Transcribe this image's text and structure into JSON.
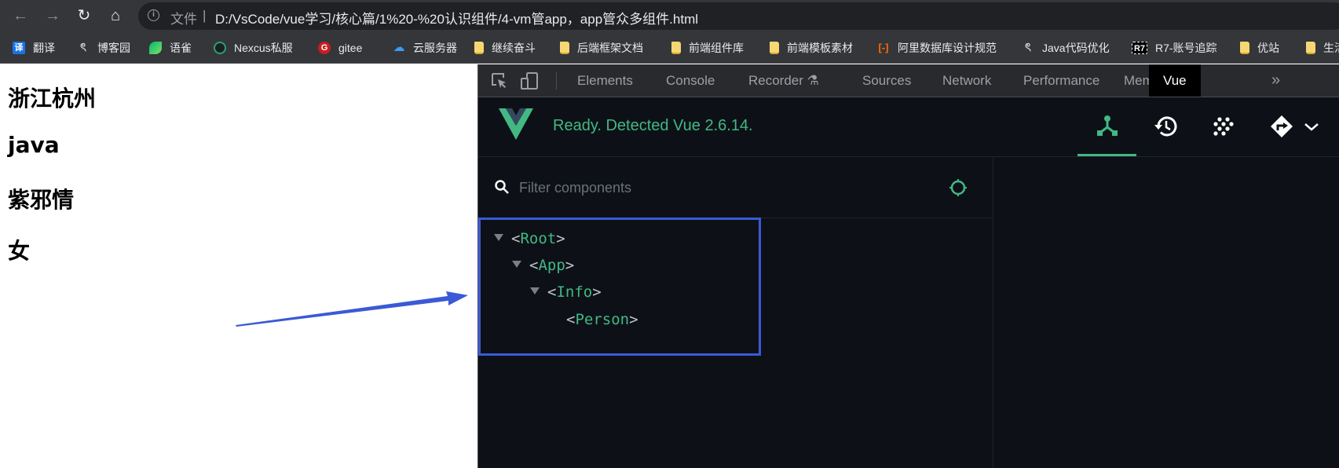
{
  "browser": {
    "nav": {
      "back": "←",
      "forward": "→",
      "reload": "↻",
      "home": "⌂"
    },
    "address": {
      "info_icon": "i",
      "scheme_label": "文件",
      "separator": "|",
      "url": "D:/VsCode/vue学习/核心篇/1%20-%20认识组件/4-vm管app，app管众多组件.html"
    },
    "bookmarks": [
      {
        "label": "翻译",
        "icon": "translate-icon",
        "glyph": "译"
      },
      {
        "label": "博客园",
        "icon": "cnblogs-icon",
        "glyph": "ৎ"
      },
      {
        "label": "语雀",
        "icon": "yuque-icon",
        "glyph": ""
      },
      {
        "label": "Nexcus私服",
        "icon": "nexus-icon",
        "glyph": ""
      },
      {
        "label": "gitee",
        "icon": "gitee-icon",
        "glyph": "G"
      },
      {
        "label": "云服务器",
        "icon": "cloud-icon",
        "glyph": "☁"
      },
      {
        "label": "继续奋斗",
        "icon": "folder-icon",
        "glyph": ""
      },
      {
        "label": "后端框架文档",
        "icon": "folder-icon",
        "glyph": ""
      },
      {
        "label": "前端组件库",
        "icon": "folder-icon",
        "glyph": ""
      },
      {
        "label": "前端模板素材",
        "icon": "folder-icon",
        "glyph": ""
      },
      {
        "label": "阿里数据库设计规范",
        "icon": "aliyun-icon",
        "glyph": "[-]"
      },
      {
        "label": "Java代码优化",
        "icon": "cnblogs-icon",
        "glyph": "ৎ"
      },
      {
        "label": "R7-账号追踪",
        "icon": "r7-icon",
        "glyph": "R7"
      },
      {
        "label": "优站",
        "icon": "folder-icon",
        "glyph": ""
      },
      {
        "label": "生活",
        "icon": "folder-icon",
        "glyph": ""
      }
    ]
  },
  "page": {
    "lines": [
      "浙江杭州",
      "java",
      "紫邪情",
      "女"
    ]
  },
  "devtools": {
    "tabs": [
      {
        "label": "Elements",
        "active": false
      },
      {
        "label": "Console",
        "active": false
      },
      {
        "label": "Recorder ⚗",
        "active": false
      },
      {
        "label": "Sources",
        "active": false
      },
      {
        "label": "Network",
        "active": false
      },
      {
        "label": "Performance",
        "active": false
      },
      {
        "label": "Memory",
        "active": false
      },
      {
        "label": "Vue",
        "active": true
      }
    ],
    "more_tabs": "»",
    "vue": {
      "status": "Ready. Detected Vue 2.6.14.",
      "accent": "#42b883",
      "filter_placeholder": "Filter components",
      "tree": [
        {
          "name": "Root",
          "depth": 0,
          "expanded": true
        },
        {
          "name": "App",
          "depth": 1,
          "expanded": true
        },
        {
          "name": "Info",
          "depth": 2,
          "expanded": true
        },
        {
          "name": "Person",
          "depth": 3,
          "expanded": null
        }
      ]
    }
  },
  "annotation": {
    "color": "#3a5ad6"
  }
}
